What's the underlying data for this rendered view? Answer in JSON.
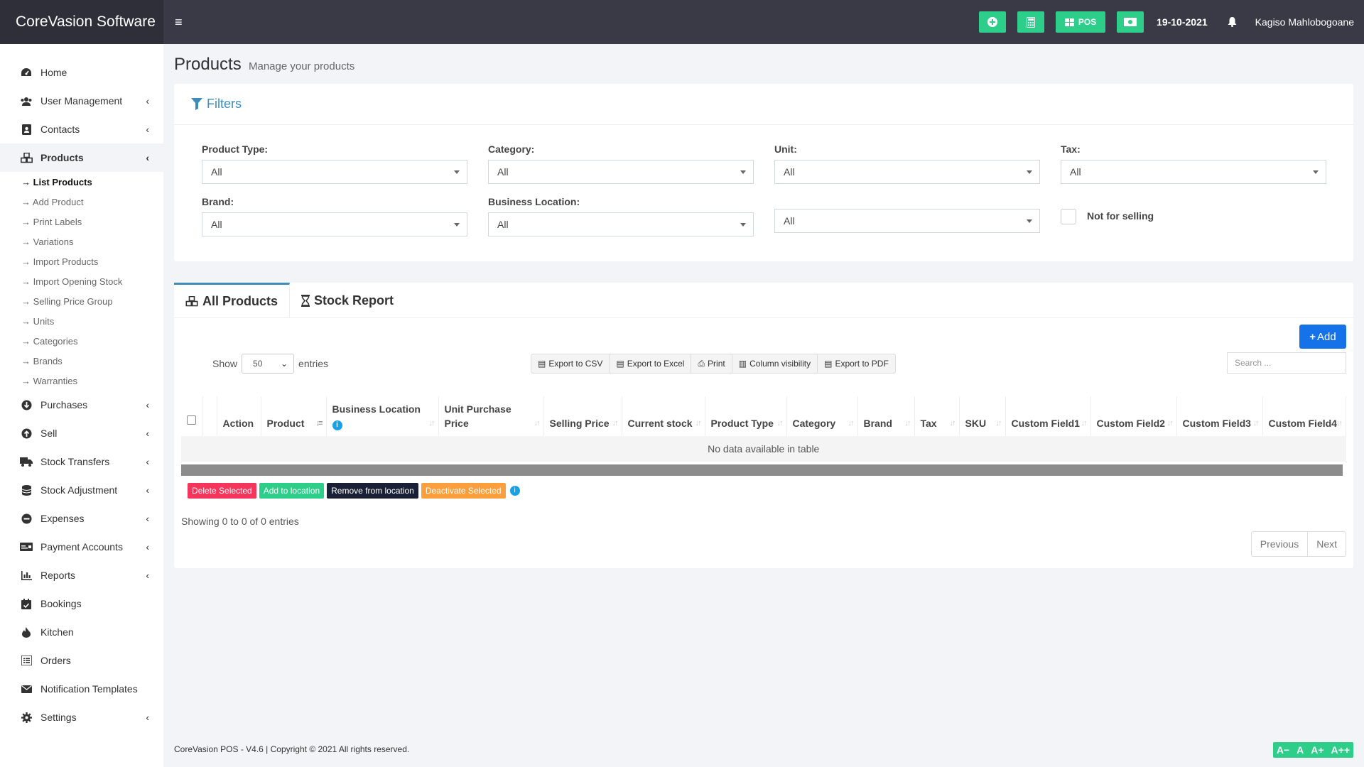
{
  "app": {
    "brand": "CoreVasion Software"
  },
  "topbar": {
    "hamburger": "≡",
    "pos_label": "POS",
    "date": "19-10-2021",
    "user_name": "Kagiso Mahlobogoane"
  },
  "sidebar": {
    "items": [
      {
        "label": "Home",
        "icon": "dashboard-icon",
        "chevron": ""
      },
      {
        "label": "User Management",
        "icon": "users-icon",
        "chevron": "‹"
      },
      {
        "label": "Contacts",
        "icon": "address-book-icon",
        "chevron": "‹"
      },
      {
        "label": "Products",
        "icon": "cubes-icon",
        "chevron": "‹"
      },
      {
        "label": "Purchases",
        "icon": "arrow-circle-down-icon",
        "chevron": "‹"
      },
      {
        "label": "Sell",
        "icon": "arrow-circle-up-icon",
        "chevron": "‹"
      },
      {
        "label": "Stock Transfers",
        "icon": "truck-icon",
        "chevron": "‹"
      },
      {
        "label": "Stock Adjustment",
        "icon": "database-icon",
        "chevron": "‹"
      },
      {
        "label": "Expenses",
        "icon": "minus-circle-icon",
        "chevron": "‹"
      },
      {
        "label": "Payment Accounts",
        "icon": "money-check-icon",
        "chevron": "‹"
      },
      {
        "label": "Reports",
        "icon": "chart-bar-icon",
        "chevron": "‹"
      },
      {
        "label": "Bookings",
        "icon": "calendar-check-icon",
        "chevron": ""
      },
      {
        "label": "Kitchen",
        "icon": "fire-icon",
        "chevron": ""
      },
      {
        "label": "Orders",
        "icon": "list-icon",
        "chevron": ""
      },
      {
        "label": "Notification Templates",
        "icon": "envelope-icon",
        "chevron": ""
      },
      {
        "label": "Settings",
        "icon": "cog-icon",
        "chevron": "‹"
      }
    ],
    "sub_items": [
      "→ List Products",
      "→ Add Product",
      "→ Print Labels",
      "→ Variations",
      "→ Import Products",
      "→ Import Opening Stock",
      "→ Selling Price Group",
      "→ Units",
      "→ Categories",
      "→ Brands",
      "→ Warranties"
    ]
  },
  "page": {
    "title": "Products",
    "subtitle": "Manage your products"
  },
  "filters": {
    "heading": "Filters",
    "product_type": {
      "label": "Product Type:",
      "value": "All"
    },
    "category": {
      "label": "Category:",
      "value": "All"
    },
    "unit": {
      "label": "Unit:",
      "value": "All"
    },
    "tax": {
      "label": "Tax:",
      "value": "All"
    },
    "brand": {
      "label": "Brand:",
      "value": "All"
    },
    "business_location": {
      "label": "Business Location:",
      "value": "All"
    },
    "extra": {
      "value": "All"
    },
    "not_for_selling": "Not for selling"
  },
  "products": {
    "tabs": [
      "All Products",
      "Stock Report"
    ],
    "add_label": "Add",
    "show_label": "Show",
    "entries_label": "entries",
    "page_length": "50",
    "export_buttons": [
      "Export to CSV",
      "Export to Excel",
      "Print",
      "Column visibility",
      "Export to PDF"
    ],
    "search_placeholder": "Search ...",
    "columns": [
      "Action",
      "Product",
      "Business Location",
      "Unit Purchase Price",
      "Selling Price",
      "Current stock",
      "Product Type",
      "Category",
      "Brand",
      "Tax",
      "SKU",
      "Custom Field1",
      "Custom Field2",
      "Custom Field3",
      "Custom Field4"
    ],
    "empty_message": "No data available in table",
    "bulk_actions": [
      {
        "label": "Delete Selected",
        "color": "#f5365c"
      },
      {
        "label": "Add to location",
        "color": "#2dce89"
      },
      {
        "label": "Remove from location",
        "color": "#1a2035"
      },
      {
        "label": "Deactivate Selected",
        "color": "#fb9f3c"
      }
    ],
    "showing": "Showing 0 to 0 of 0 entries",
    "pager": {
      "previous": "Previous",
      "next": "Next"
    }
  },
  "footer": {
    "copyright": "CoreVasion POS - V4.6 | Copyright © 2021 All rights reserved.",
    "font_tools": [
      "A−",
      "A",
      "A+",
      "A++"
    ]
  },
  "colors": {
    "accent_green": "#2dce89",
    "primary_blue": "#1572e8",
    "link_blue": "#3c8dbc",
    "topbar": "#3a3a47"
  }
}
